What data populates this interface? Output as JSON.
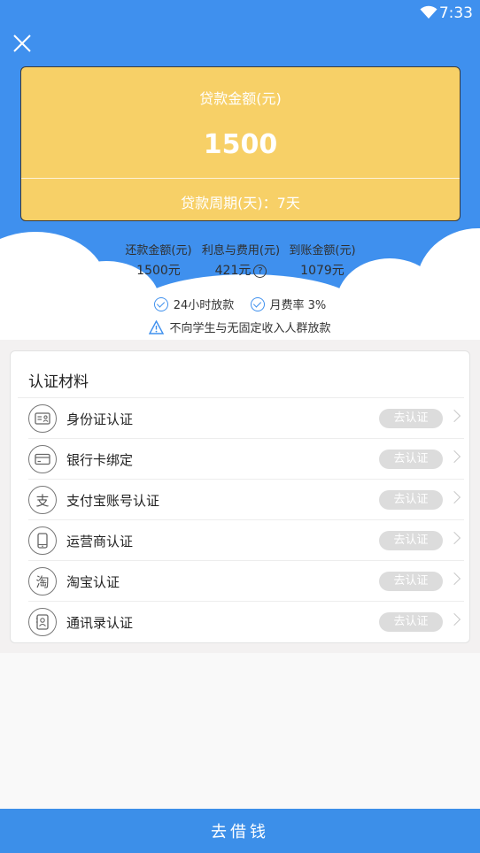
{
  "status_bar": {
    "time": "7:33"
  },
  "card": {
    "label": "贷款金额(元)",
    "amount": "1500",
    "period": "贷款周期(天)：7天"
  },
  "summary": [
    {
      "label": "还款金额(元)",
      "value": "1500元"
    },
    {
      "label": "利息与费用(元)",
      "value": "421元"
    },
    {
      "label": "到账金额(元)",
      "value": "1079元"
    }
  ],
  "promises": {
    "fast": "24小时放款",
    "rate": "月费率 3%",
    "warning": "不向学生与无固定收入人群放款"
  },
  "materials": {
    "title": "认证材料",
    "action_label": "去认证",
    "items": [
      {
        "label": "身份证认证",
        "icon": "id-card-icon"
      },
      {
        "label": "银行卡绑定",
        "icon": "bank-card-icon"
      },
      {
        "label": "支付宝账号认证",
        "icon": "alipay-icon"
      },
      {
        "label": "运营商认证",
        "icon": "phone-icon"
      },
      {
        "label": "淘宝认证",
        "icon": "taobao-icon"
      },
      {
        "label": "通讯录认证",
        "icon": "contacts-icon"
      }
    ]
  },
  "footer": {
    "button": "去借钱"
  },
  "colors": {
    "primary": "#3f90ee",
    "card": "#f7d067",
    "disabled": "#dcdcdc"
  }
}
